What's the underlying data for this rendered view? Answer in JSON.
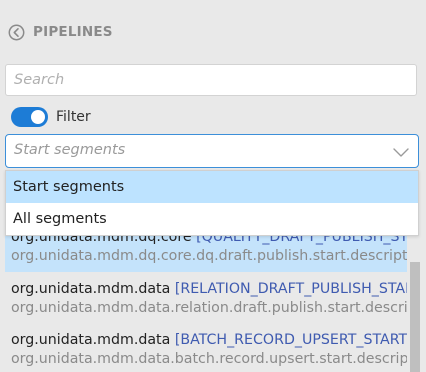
{
  "header": {
    "title": "PIPELINES",
    "back_icon": "back-arrow-circle-icon"
  },
  "search": {
    "placeholder": "Search",
    "value": ""
  },
  "filter": {
    "label": "Filter",
    "enabled": true,
    "accent": "#1d7cd6"
  },
  "select": {
    "value": "Start segments",
    "options": [
      "Start segments",
      "All segments"
    ],
    "highlighted": "Start segments"
  },
  "list": {
    "items": [
      {
        "package": "org.unidata.mdm.dq.core",
        "tag": "[QUALITY_DRAFT_PUBLISH_START]",
        "description": "org.unidata.mdm.dq.core.dq.draft.publish.start.description",
        "selected": true
      },
      {
        "package": "org.unidata.mdm.data",
        "tag": "[RELATION_DRAFT_PUBLISH_START]",
        "description": "org.unidata.mdm.data.relation.draft.publish.start.description",
        "selected": false
      },
      {
        "package": "org.unidata.mdm.data",
        "tag": "[BATCH_RECORD_UPSERT_START]",
        "description": "org.unidata.mdm.data.batch.record.upsert.start.description",
        "selected": false
      }
    ]
  }
}
